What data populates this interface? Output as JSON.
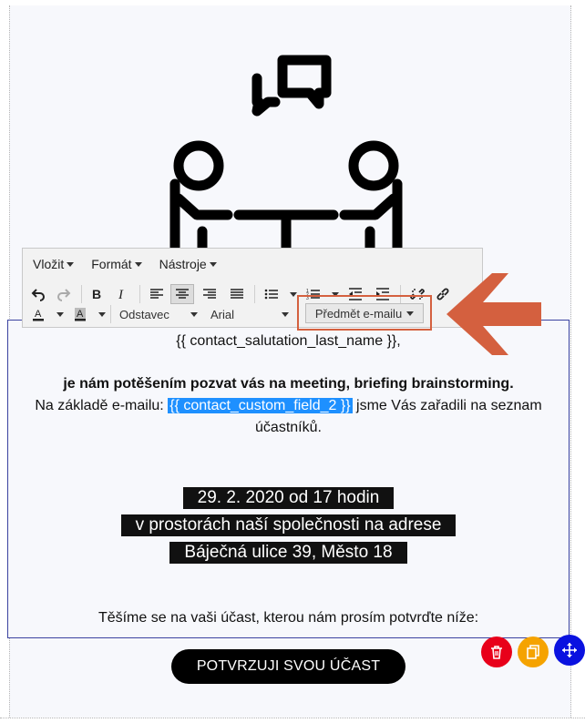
{
  "toolbar": {
    "menus": [
      "Vložit",
      "Formát",
      "Nástroje"
    ],
    "block_format": "Odstavec",
    "font_family": "Arial",
    "subject_button": "Předmět e-mailu"
  },
  "email": {
    "salutation": "{{ contact_salutation_last_name }},",
    "invite_line": "je nám potěšením pozvat vás na meeting, briefing brainstorming.",
    "basis_prefix": "Na základě e-mailu:",
    "custom_field": "{{ contact_custom_field_2 }}",
    "basis_suffix": "jsme Vás zařadili na seznam",
    "basis_line2": "účastníků.",
    "date_line": "29. 2. 2020 od 17 hodin",
    "place_line": "v prostorách naší společnosti na adrese",
    "address_line": "Báječná ulice 39, Město 18",
    "closing": "Těšíme se na vaši účast, kterou nám prosím potvrďte níže:",
    "confirm_button": "POTVRZUJI SVOU ÚČAST"
  },
  "colors": {
    "delete": "#e8001a",
    "copy": "#f5a300",
    "move": "#0a12e0",
    "arrow": "#d4603f",
    "highlight": "#1e90ff"
  }
}
